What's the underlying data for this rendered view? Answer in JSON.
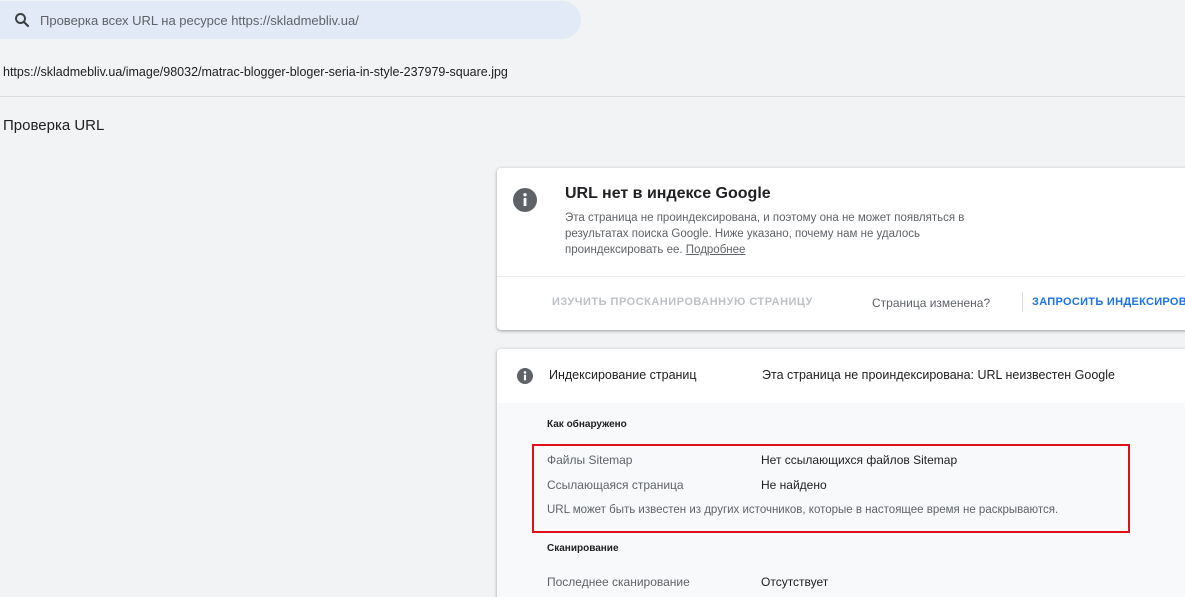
{
  "search": {
    "placeholder": "Проверка всех URL на ресурсе https://skladmebliv.ua/",
    "icon": "search-icon"
  },
  "inspected_url": "https://skladmebliv.ua/image/98032/matrac-blogger-bloger-seria-in-style-237979-square.jpg",
  "page_title": "Проверка URL",
  "status_card": {
    "icon": "info-icon",
    "title": "URL нет в индексе Google",
    "description_line1": "Эта страница не проиндексирована, и поэтому она не может появляться в",
    "description_line2": "результатах поиска Google. Ниже указано, почему нам не удалось",
    "description_line3": "проиндексировать ее.",
    "learn_more": "Подробнее",
    "view_crawled_label": "ИЗУЧИТЬ ПРОСКАНИРОВАННУЮ СТРАНИЦУ",
    "page_changed_label": "Страница изменена?",
    "request_indexing_label": "ЗАПРОСИТЬ ИНДЕКСИРОВА"
  },
  "detail_card": {
    "icon": "info-icon",
    "label": "Индексирование страниц",
    "value": "Эта страница не проиндексирована: URL неизвестен Google",
    "discovery": {
      "heading": "Как обнаружено",
      "rows": [
        {
          "label": "Файлы Sitemap",
          "value": "Нет ссылающихся файлов Sitemap"
        },
        {
          "label": "Ссылающаяся страница",
          "value": "Не найдено"
        }
      ],
      "note": "URL может быть известен из других источников, которые в настоящее время не раскрываются."
    },
    "crawl": {
      "heading": "Сканирование",
      "rows": [
        {
          "label": "Последнее сканирование",
          "value": "Отсутствует"
        }
      ]
    }
  },
  "colors": {
    "highlight": "#e0101a",
    "accent": "#1a73e8",
    "search_bg": "#e3eaf7"
  }
}
